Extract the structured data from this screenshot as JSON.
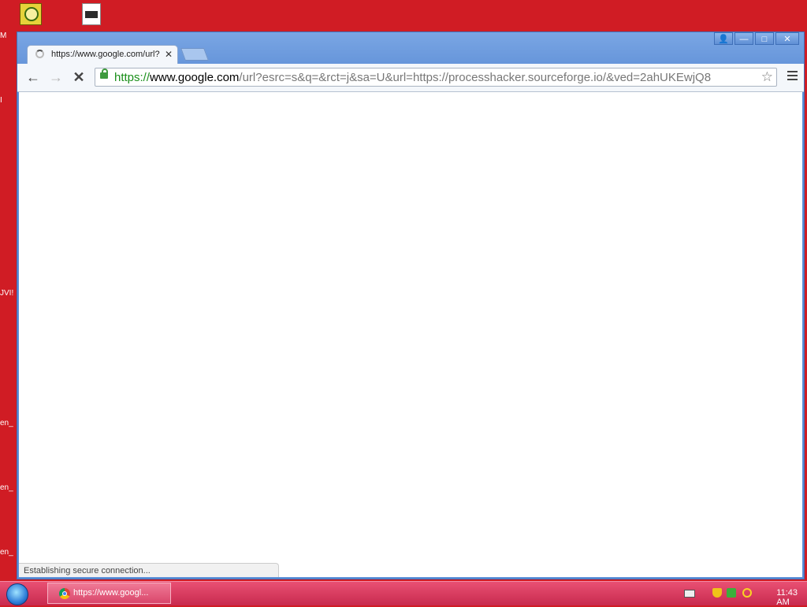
{
  "desktop": {
    "side_labels": [
      "M",
      "I",
      "JVI!",
      "en_",
      "en_",
      "en_"
    ]
  },
  "browser": {
    "tab": {
      "title": "https://www.google.com/url?esrc=s&q=&rct=j&sa=U&url=https://processhacker.sourceforge.io/",
      "close_glyph": "✕"
    },
    "window_controls": {
      "user": "👤",
      "minimize": "—",
      "maximize": "□",
      "close": "✕"
    },
    "nav": {
      "back": "←",
      "forward": "→",
      "stop": "✕"
    },
    "url": {
      "scheme": "https://",
      "host": "www.google.com",
      "path": "/url?esrc=s&q=&rct=j&sa=U&url=https://processhacker.sourceforge.io/&ved=2ahUKEwjQ8"
    },
    "bookmark_star": "☆",
    "status_text": "Establishing secure connection..."
  },
  "taskbar": {
    "task_label": "https://www.googl...",
    "clock": "11:43 AM"
  },
  "colors": {
    "desktop": "#d01c24",
    "taskbar": "#d9466b",
    "window_frame": "#5d8ed6",
    "secure_green": "#1a8f1a"
  }
}
